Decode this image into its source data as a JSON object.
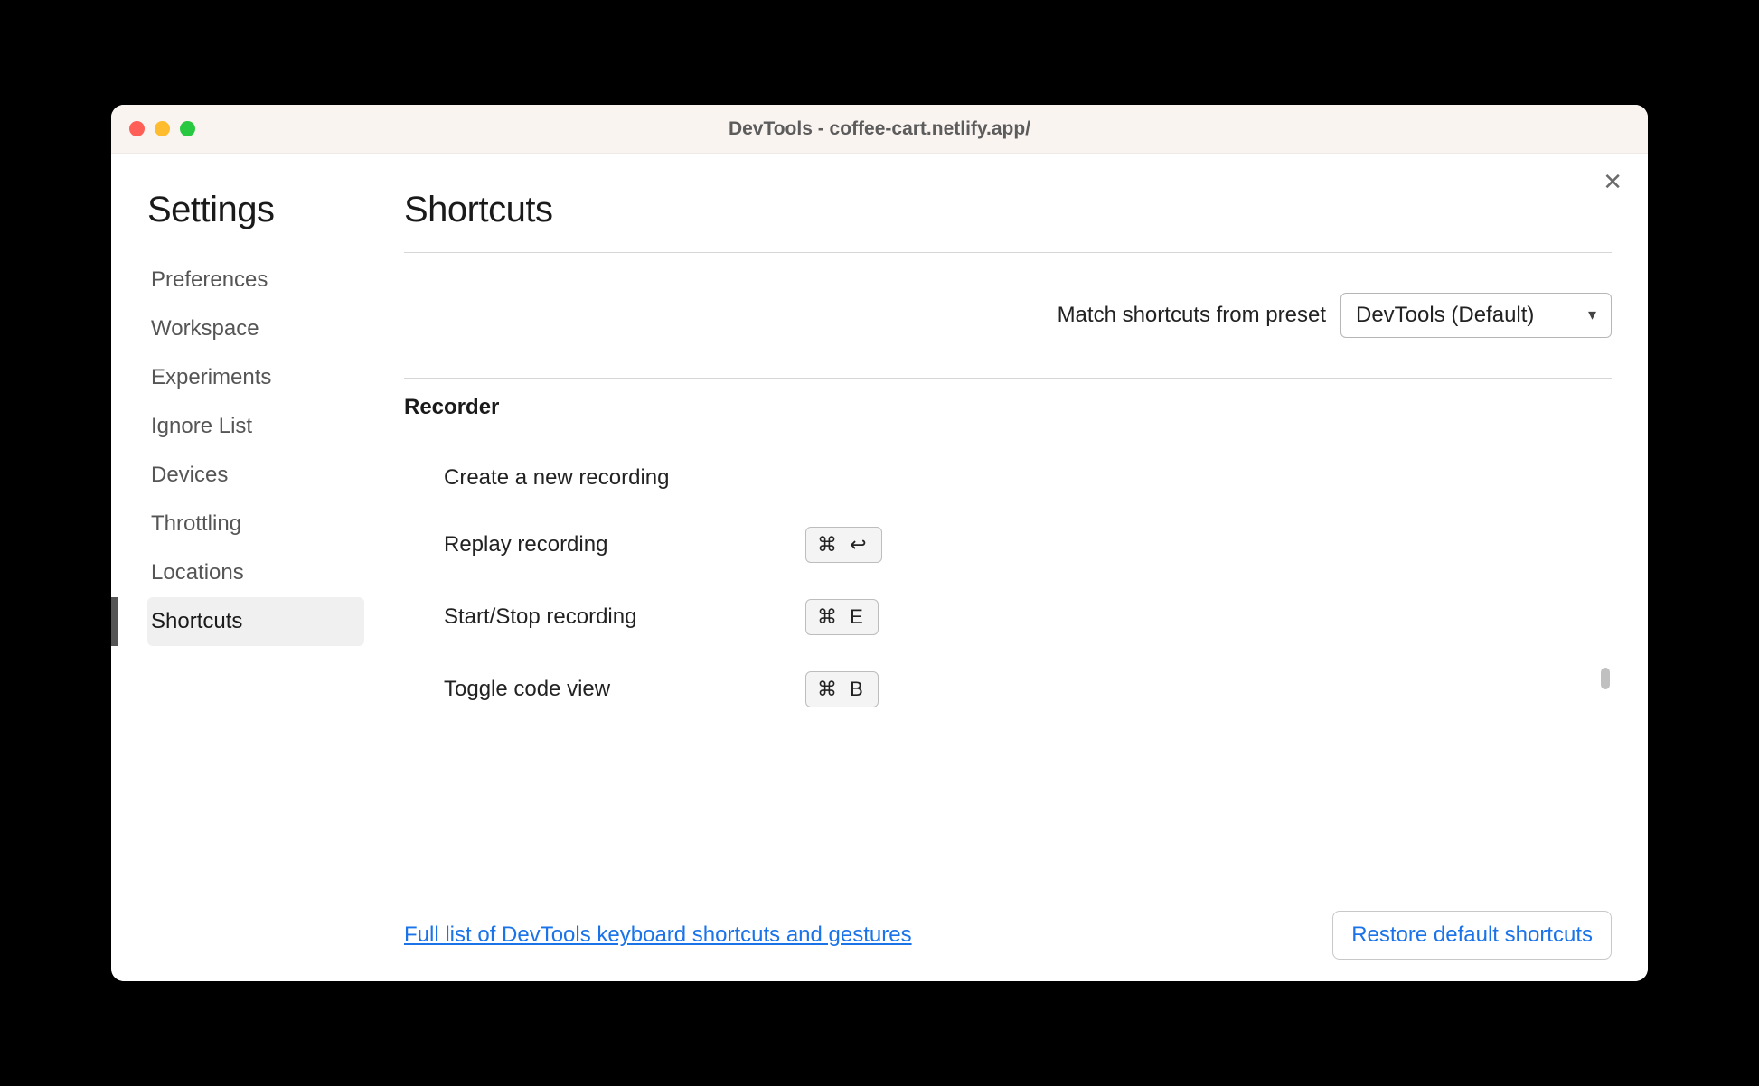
{
  "titlebar": {
    "title": "DevTools - coffee-cart.netlify.app/"
  },
  "sidebar": {
    "title": "Settings",
    "items": [
      {
        "label": "Preferences",
        "active": false
      },
      {
        "label": "Workspace",
        "active": false
      },
      {
        "label": "Experiments",
        "active": false
      },
      {
        "label": "Ignore List",
        "active": false
      },
      {
        "label": "Devices",
        "active": false
      },
      {
        "label": "Throttling",
        "active": false
      },
      {
        "label": "Locations",
        "active": false
      },
      {
        "label": "Shortcuts",
        "active": true
      }
    ]
  },
  "main": {
    "title": "Shortcuts",
    "preset_label": "Match shortcuts from preset",
    "preset_value": "DevTools (Default)",
    "section": {
      "title": "Recorder",
      "rows": [
        {
          "label": "Create a new recording",
          "keys": ""
        },
        {
          "label": "Replay recording",
          "keys": "⌘ ↩"
        },
        {
          "label": "Start/Stop recording",
          "keys": "⌘ E"
        },
        {
          "label": "Toggle code view",
          "keys": "⌘ B"
        }
      ]
    },
    "footer_link": "Full list of DevTools keyboard shortcuts and gestures",
    "footer_button": "Restore default shortcuts"
  },
  "icons": {
    "close": "✕"
  }
}
